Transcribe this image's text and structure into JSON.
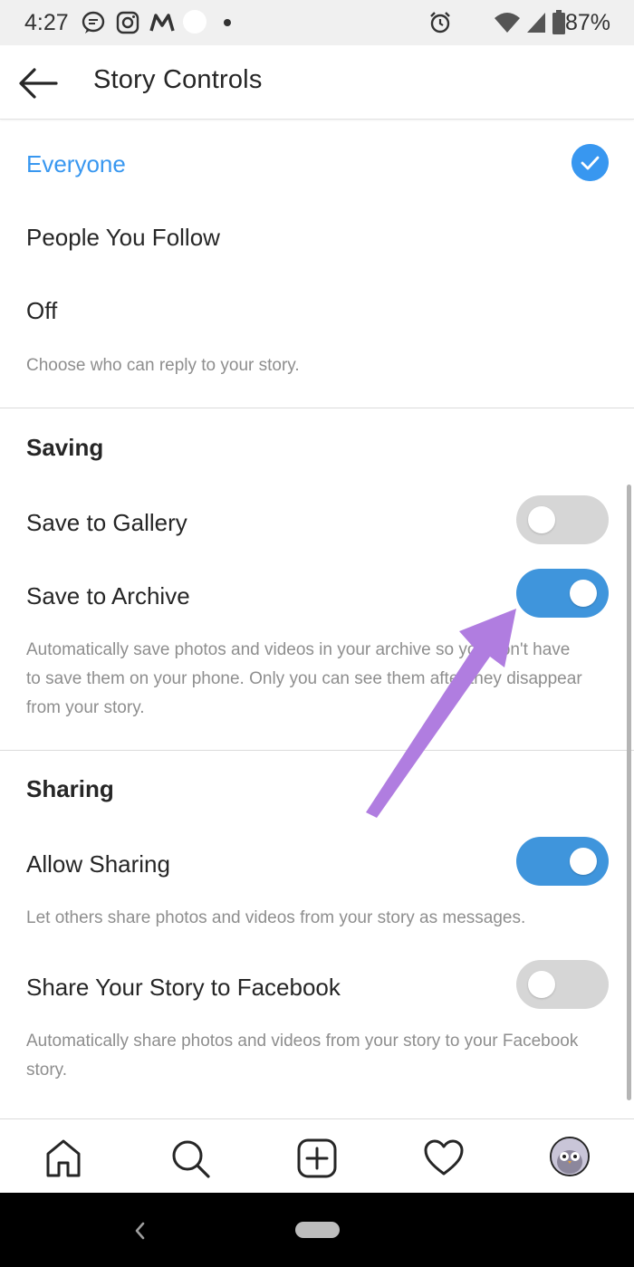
{
  "status_bar": {
    "time": "4:27",
    "battery": "87%"
  },
  "header": {
    "title": "Story Controls"
  },
  "replies": {
    "options": [
      {
        "label": "Everyone",
        "selected": true
      },
      {
        "label": "People You Follow",
        "selected": false
      },
      {
        "label": "Off",
        "selected": false
      }
    ],
    "description": "Choose who can reply to your story."
  },
  "saving": {
    "title": "Saving",
    "save_to_gallery": {
      "label": "Save to Gallery",
      "enabled": false
    },
    "save_to_archive": {
      "label": "Save to Archive",
      "enabled": true
    },
    "description": "Automatically save photos and videos in your archive so you don't have to save them on your phone. Only you can see them after they disappear from your story."
  },
  "sharing": {
    "title": "Sharing",
    "allow_sharing": {
      "label": "Allow Sharing",
      "enabled": true
    },
    "allow_sharing_description": "Let others share photos and videos from your story as messages.",
    "share_to_facebook": {
      "label": "Share Your Story to Facebook",
      "enabled": false
    },
    "share_to_facebook_description": "Automatically share photos and videos from your story to your Facebook story."
  },
  "colors": {
    "accent": "#3897f0",
    "toggle_on": "#3f95dc",
    "toggle_off": "#d6d6d6",
    "annotation_arrow": "#b07de0"
  },
  "icons": {
    "tabs": [
      "home-icon",
      "search-icon",
      "add-post-icon",
      "heart-icon",
      "profile-avatar"
    ]
  }
}
